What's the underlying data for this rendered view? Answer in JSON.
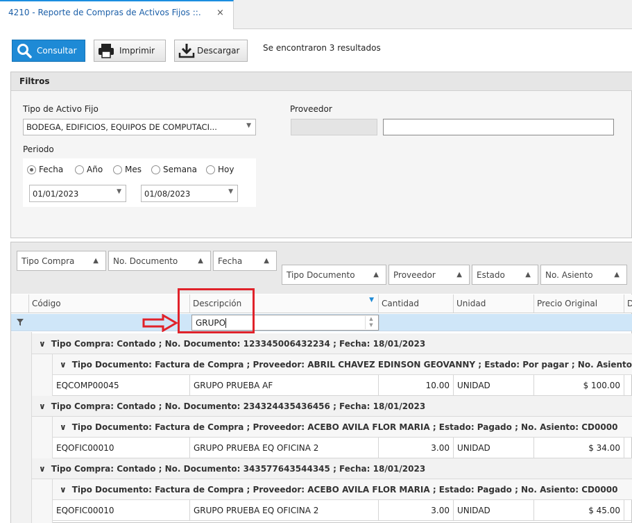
{
  "tab": {
    "title": "4210 - Reporte de Compras de Activos Fijos ::.",
    "close": "×"
  },
  "toolbar": {
    "consultar": "Consultar",
    "imprimir": "Imprimir",
    "descargar": "Descargar",
    "results": "Se encontraron 3 resultados"
  },
  "filters": {
    "title": "Filtros",
    "tipo_activo_label": "Tipo de Activo Fijo",
    "tipo_activo_value": "BODEGA, EDIFICIOS, EQUIPOS DE COMPUTACI...",
    "proveedor_label": "Proveedor",
    "proveedor_code": "",
    "proveedor_name": "",
    "periodo_label": "Periodo",
    "periodo_options": [
      "Fecha",
      "Año",
      "Mes",
      "Semana",
      "Hoy"
    ],
    "periodo_selected": "Fecha",
    "date_from": "01/01/2023",
    "date_to": "01/08/2023"
  },
  "group_by": [
    "Tipo Compra",
    "No. Documento",
    "Fecha",
    "Tipo Documento",
    "Proveedor",
    "Estado",
    "No. Asiento"
  ],
  "columns": [
    "Código",
    "Descripción",
    "Cantidad",
    "Unidad",
    "Precio Original",
    "D"
  ],
  "filter_value": "GRUPO",
  "groups": [
    {
      "header": "Tipo Compra: Contado ; No. Documento: 123345006432234 ; Fecha: 18/01/2023",
      "sub": "Tipo Documento: Factura de Compra ; Proveedor: ABRIL CHAVEZ EDINSON GEOVANNY ; Estado: Por pagar ; No. Asiento",
      "row": {
        "codigo": "EQCOMP00045",
        "descripcion": "GRUPO PRUEBA AF",
        "cantidad": "10.00",
        "unidad": "UNIDAD",
        "precio": "$ 100.00"
      }
    },
    {
      "header": "Tipo Compra: Contado ; No. Documento: 234324435436456 ; Fecha: 18/01/2023",
      "sub": "Tipo Documento: Factura de Compra ; Proveedor: ACEBO AVILA FLOR MARIA ; Estado: Pagado ; No. Asiento: CD0000",
      "row": {
        "codigo": "EQOFIC00010",
        "descripcion": "GRUPO PRUEBA EQ OFICINA 2",
        "cantidad": "3.00",
        "unidad": "UNIDAD",
        "precio": "$ 34.00"
      }
    },
    {
      "header": "Tipo Compra: Contado ; No. Documento: 343577643544345 ; Fecha: 18/01/2023",
      "sub": "Tipo Documento: Factura de Compra ; Proveedor: ACEBO AVILA FLOR MARIA ; Estado: Pagado ; No. Asiento: CD0000",
      "row": {
        "codigo": "EQOFIC00010",
        "descripcion": "GRUPO PRUEBA EQ OFICINA 2",
        "cantidad": "3.00",
        "unidad": "UNIDAD",
        "precio": "$ 45.00"
      }
    }
  ],
  "colors": {
    "accent": "#1e8ad6",
    "annotation": "#e0222a",
    "filter_row": "#cfe6f8"
  }
}
